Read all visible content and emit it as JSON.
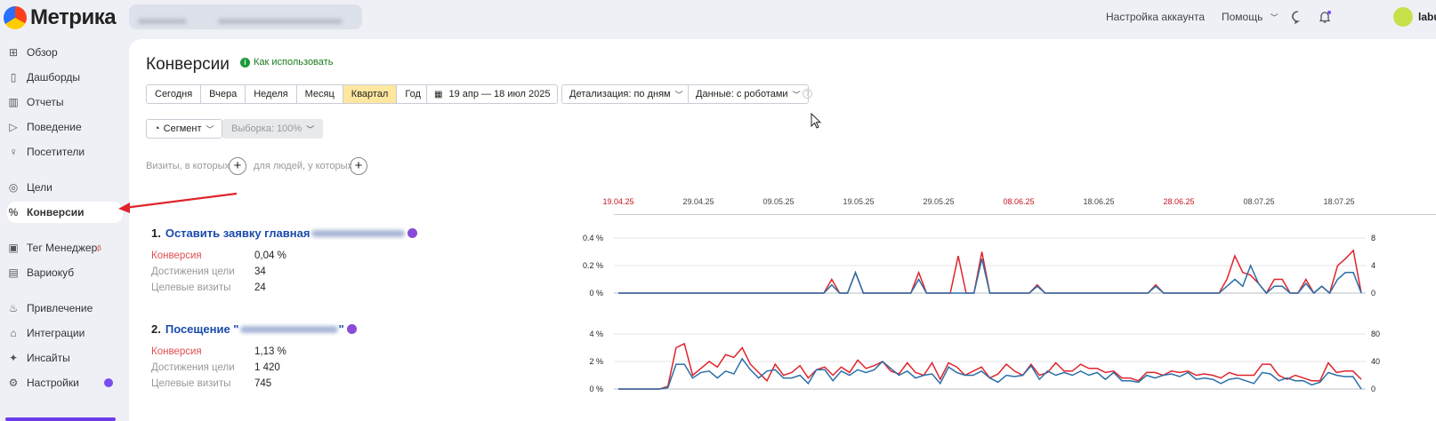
{
  "app": {
    "logo_text": "Метрика"
  },
  "topnav": {
    "account_settings": "Настройка аккаунта",
    "help": "Помощь",
    "user_name": "labu"
  },
  "sidebar": {
    "items": [
      {
        "label": "Обзор",
        "icon": "grid-icon"
      },
      {
        "label": "Дашборды",
        "icon": "dashboard-icon"
      },
      {
        "label": "Отчеты",
        "icon": "bar-chart-icon"
      },
      {
        "label": "Поведение",
        "icon": "play-icon"
      },
      {
        "label": "Посетители",
        "icon": "user-icon"
      },
      {
        "label": "Цели",
        "icon": "target-icon"
      },
      {
        "label": "Конверсии",
        "icon": "percent-icon",
        "active": true
      },
      {
        "label": "Тег Менеджер",
        "icon": "tag-manager-icon",
        "badge": "β"
      },
      {
        "label": "Вариокуб",
        "icon": "variocube-icon"
      },
      {
        "label": "Привлечение",
        "icon": "flame-icon"
      },
      {
        "label": "Интеграции",
        "icon": "integrations-icon"
      },
      {
        "label": "Инсайты",
        "icon": "sparkle-icon"
      },
      {
        "label": "Настройки",
        "icon": "gear-icon"
      }
    ]
  },
  "page": {
    "title": "Конверсии",
    "how_to_use": "Как использовать"
  },
  "periods": [
    "Сегодня",
    "Вчера",
    "Неделя",
    "Месяц",
    "Квартал",
    "Год"
  ],
  "active_period": "Квартал",
  "date_range": "19 апр — 18 июл 2025",
  "detail": "Детализация: по дням",
  "data_mode": "Данные: с роботами",
  "segment": "Сегмент",
  "sample": "Выборка: 100%",
  "filters": {
    "visits_label": "Визиты, в которых",
    "people_label": "для людей, у которых"
  },
  "date_axis": [
    {
      "label": "19.04.25",
      "weekend": true
    },
    {
      "label": "29.04.25",
      "weekend": false
    },
    {
      "label": "09.05.25",
      "weekend": false
    },
    {
      "label": "19.05.25",
      "weekend": false
    },
    {
      "label": "29.05.25",
      "weekend": false
    },
    {
      "label": "08.06.25",
      "weekend": true
    },
    {
      "label": "18.06.25",
      "weekend": false
    },
    {
      "label": "28.06.25",
      "weekend": true
    },
    {
      "label": "08.07.25",
      "weekend": false
    },
    {
      "label": "18.07.25",
      "weekend": false
    }
  ],
  "goals": [
    {
      "number": "1.",
      "name": "Оставить заявку главная",
      "metrics": [
        {
          "label": "Конверсия",
          "value": "0,04 %"
        },
        {
          "label": "Достижения цели",
          "value": "34"
        },
        {
          "label": "Целевые визиты",
          "value": "24"
        }
      ]
    },
    {
      "number": "2.",
      "name": "Посещение \"",
      "name_suffix": "\"",
      "metrics": [
        {
          "label": "Конверсия",
          "value": "1,13 %"
        },
        {
          "label": "Достижения цели",
          "value": "1 420"
        },
        {
          "label": "Целевые визиты",
          "value": "745"
        }
      ]
    }
  ],
  "chart_data": [
    {
      "type": "line",
      "title": "",
      "y_left_ticks": [
        "0.4 %",
        "0.2 %",
        "0 %"
      ],
      "y_right_ticks": [
        "8",
        "4",
        "0"
      ],
      "ylim_left": [
        0,
        0.4
      ],
      "ylim_right": [
        0,
        8
      ],
      "days": 91,
      "series": [
        {
          "color": "#e0242c",
          "values": [
            0,
            0,
            0,
            0,
            0,
            0,
            0,
            0,
            0,
            0,
            0,
            0,
            0,
            0,
            0,
            0,
            0,
            0,
            0,
            0,
            0,
            0,
            0,
            0,
            0,
            0,
            0,
            0.1,
            0,
            0,
            0.15,
            0,
            0,
            0,
            0,
            0,
            0,
            0,
            0.15,
            0,
            0,
            0,
            0,
            0.27,
            0,
            0,
            0.3,
            0,
            0,
            0,
            0,
            0,
            0,
            0.06,
            0,
            0,
            0,
            0,
            0,
            0,
            0,
            0,
            0,
            0,
            0,
            0,
            0,
            0,
            0.06,
            0,
            0,
            0,
            0,
            0,
            0,
            0,
            0,
            0.1,
            0.27,
            0.15,
            0.13,
            0.07,
            0,
            0.1,
            0.1,
            0,
            0,
            0.1,
            0,
            0.05,
            0,
            0.2,
            0.25,
            0.31,
            0
          ]
        },
        {
          "color": "#2a6fa8",
          "values": [
            0,
            0,
            0,
            0,
            0,
            0,
            0,
            0,
            0,
            0,
            0,
            0,
            0,
            0,
            0,
            0,
            0,
            0,
            0,
            0,
            0,
            0,
            0,
            0,
            0,
            0,
            0,
            0.06,
            0,
            0,
            0.15,
            0,
            0,
            0,
            0,
            0,
            0,
            0,
            0.1,
            0,
            0,
            0,
            0,
            0,
            0,
            0,
            0.25,
            0,
            0,
            0,
            0,
            0,
            0,
            0.05,
            0,
            0,
            0,
            0,
            0,
            0,
            0,
            0,
            0,
            0,
            0,
            0,
            0,
            0,
            0.05,
            0,
            0,
            0,
            0,
            0,
            0,
            0,
            0,
            0.05,
            0.1,
            0.05,
            0.2,
            0.07,
            0,
            0.05,
            0.05,
            0,
            0,
            0.07,
            0,
            0.05,
            0,
            0.1,
            0.15,
            0.15,
            0
          ]
        }
      ]
    },
    {
      "type": "line",
      "title": "",
      "y_left_ticks": [
        "4 %",
        "2 %",
        "0 %"
      ],
      "y_right_ticks": [
        "80",
        "40",
        "0"
      ],
      "ylim_left": [
        0,
        4
      ],
      "ylim_right": [
        0,
        80
      ],
      "days": 91,
      "series": [
        {
          "color": "#e0242c",
          "values": [
            0,
            0,
            0,
            0,
            0,
            0,
            0.2,
            3,
            3.3,
            1,
            1.5,
            2,
            1.6,
            2.5,
            2.3,
            3,
            1.8,
            1.2,
            0.6,
            1.8,
            1,
            1.2,
            1.7,
            0.8,
            1.4,
            1.6,
            1,
            1.6,
            1.2,
            2.1,
            1.5,
            1.7,
            2,
            1.3,
            1.1,
            1.9,
            1.2,
            1,
            1.9,
            0.7,
            1.9,
            1.6,
            1,
            1.3,
            1.6,
            0.8,
            1.1,
            1.8,
            1.3,
            1,
            1.8,
            1,
            1.2,
            1.9,
            1.3,
            1.3,
            1.8,
            1.5,
            1.5,
            1.2,
            1.3,
            0.8,
            0.8,
            0.6,
            1.2,
            1.2,
            1,
            1.3,
            1.2,
            1.3,
            1,
            1.1,
            1,
            0.8,
            1.2,
            1,
            1,
            1,
            1.8,
            1.8,
            1,
            0.7,
            1,
            0.8,
            0.6,
            0.6,
            1.9,
            1.2,
            1.3,
            1.3,
            0.7
          ]
        },
        {
          "color": "#2a6fa8",
          "values": [
            0,
            0,
            0,
            0,
            0,
            0,
            0.1,
            1.8,
            1.8,
            0.8,
            1.2,
            1.3,
            0.8,
            1.3,
            1.1,
            2.2,
            1.4,
            0.8,
            1.3,
            1.4,
            0.8,
            0.8,
            1,
            0.4,
            1.4,
            1.4,
            0.6,
            1.3,
            1,
            1.4,
            1.2,
            1.4,
            2,
            1.5,
            1,
            1.3,
            0.8,
            1,
            1.1,
            0.4,
            1.6,
            1.2,
            1,
            1,
            1.3,
            0.8,
            0.5,
            1,
            0.9,
            1,
            1.7,
            0.7,
            1.3,
            1,
            1.2,
            1,
            1.3,
            1,
            1.2,
            0.7,
            1.2,
            0.6,
            0.6,
            0.5,
            1,
            0.8,
            1,
            1.1,
            0.9,
            1.2,
            0.7,
            0.8,
            0.7,
            0.4,
            0.7,
            0.8,
            0.6,
            0.4,
            1.2,
            1.1,
            0.6,
            0.8,
            0.6,
            0.6,
            0.3,
            0.5,
            1.2,
            1,
            0.9,
            0.9,
            0
          ]
        }
      ]
    }
  ]
}
